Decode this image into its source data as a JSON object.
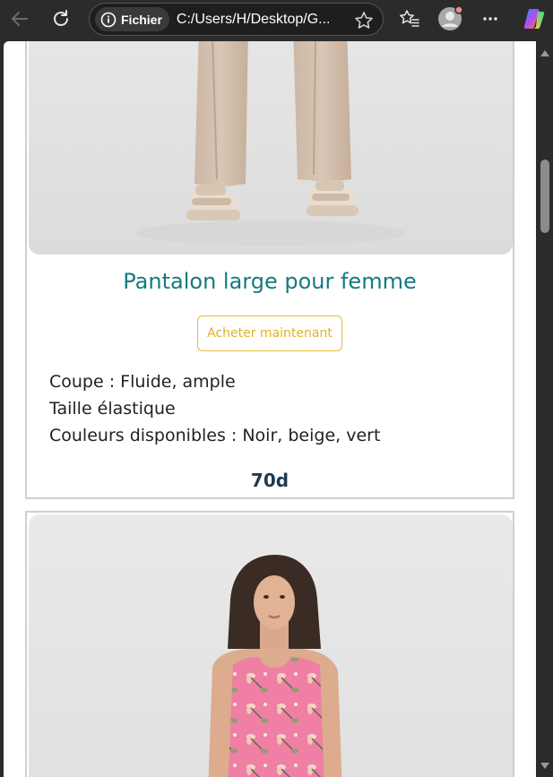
{
  "browser": {
    "site_chip": "Fichier",
    "url": "C:/Users/H/Desktop/G..."
  },
  "products": [
    {
      "title": "Pantalon large pour femme",
      "buy_label": "Acheter maintenant",
      "details": [
        "Coupe : Fluide, ample",
        "Taille élastique",
        "Couleurs disponibles : Noir, beige, vert"
      ],
      "price": "70d"
    }
  ],
  "colors": {
    "title": "#167a80",
    "button_accent": "#e0b129",
    "price": "#1c3a50"
  }
}
